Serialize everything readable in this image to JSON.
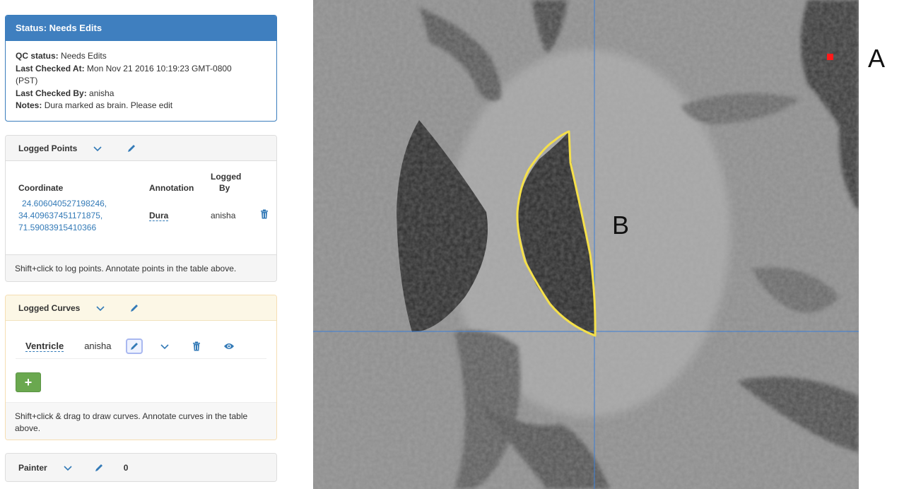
{
  "status": {
    "title": "Status: Needs Edits",
    "qc_label": "QC status:",
    "qc_value": "Needs Edits",
    "checked_at_label": "Last Checked At:",
    "checked_at_value": "Mon Nov 21 2016 10:19:23 GMT-0800",
    "checked_at_tz": "(PST)",
    "checked_by_label": "Last Checked By:",
    "checked_by_value": "anisha",
    "notes_label": "Notes:",
    "notes_value": "Dura marked as brain. Please edit"
  },
  "points": {
    "title": "Logged Points",
    "columns": [
      "Coordinate",
      "Annotation",
      "Logged By"
    ],
    "column_logged_by_line1": "Logged",
    "column_logged_by_line2": "By",
    "rows": [
      {
        "coord_line1": "24.606040527198246,",
        "coord_line2": "34.409637451171875,",
        "coord_line3": "71.59083915410366",
        "annotation": "Dura",
        "logged_by": "anisha"
      }
    ],
    "footer": "Shift+click to log points. Annotate points in the table above."
  },
  "curves": {
    "title": "Logged Curves",
    "rows": [
      {
        "name": "Ventricle",
        "user": "anisha"
      }
    ],
    "add_label": "+",
    "footer": "Shift+click & drag to draw curves. Annotate curves in the table above."
  },
  "painter": {
    "title": "Painter",
    "count": "0"
  },
  "viewer": {
    "label_a": "A",
    "label_b": "B",
    "contour_color": "#f5e04a",
    "crosshair_color": "#3d7fd6",
    "point_color": "#ff1a1a"
  },
  "icons": [
    "chevron-down-icon",
    "pencil-icon",
    "trash-icon",
    "eye-icon",
    "plus-icon"
  ],
  "colors": {
    "primary": "#337ab7",
    "status_header": "#3f7fbf",
    "success": "#6aa84f",
    "warning_header": "#fcf7e6"
  }
}
